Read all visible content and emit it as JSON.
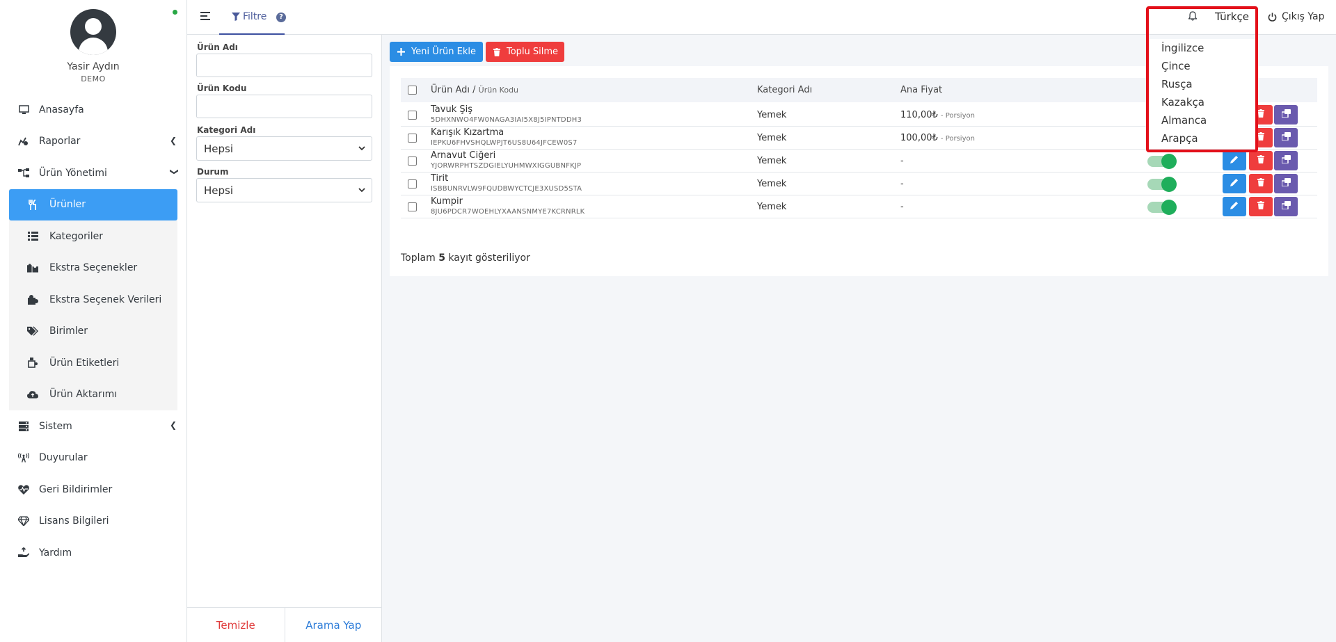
{
  "profile": {
    "name": "Yasir Aydın",
    "role": "DEMO"
  },
  "sidebar": {
    "items": [
      {
        "label": "Anasayfa",
        "icon": "monitor-icon"
      },
      {
        "label": "Raporlar",
        "icon": "reports-icon"
      },
      {
        "label": "Ürün Yönetimi",
        "icon": "sitemap-icon"
      },
      {
        "label": "Sistem",
        "icon": "server-icon"
      },
      {
        "label": "Duyurular",
        "icon": "broadcast-icon"
      },
      {
        "label": "Geri Bildirimler",
        "icon": "heart-pulse-icon"
      },
      {
        "label": "Lisans Bilgileri",
        "icon": "gem-icon"
      },
      {
        "label": "Yardım",
        "icon": "hand-holding-icon"
      }
    ],
    "sub_items": [
      {
        "label": "Ürünler",
        "icon": "utensils-icon"
      },
      {
        "label": "Kategoriler",
        "icon": "list-icon"
      },
      {
        "label": "Ekstra Seçenekler",
        "icon": "puzzle-icon"
      },
      {
        "label": "Ekstra Seçenek Verileri",
        "icon": "puzzle-piece-icon"
      },
      {
        "label": "Birimler",
        "icon": "tags-icon"
      },
      {
        "label": "Ürün Etiketleri",
        "icon": "label-icon"
      },
      {
        "label": "Ürün Aktarımı",
        "icon": "cloud-upload-icon"
      }
    ]
  },
  "topbar": {
    "filter_tab": "Filtre",
    "help": "?",
    "language": "Türkçe",
    "logout": "Çıkış Yap"
  },
  "language_menu": [
    "İngilizce",
    "Çince",
    "Rusça",
    "Kazakça",
    "Almanca",
    "Arapça"
  ],
  "filters": {
    "product_name_label": "Ürün Adı",
    "product_code_label": "Ürün Kodu",
    "category_label": "Kategori Adı",
    "category_value": "Hepsi",
    "status_label": "Durum",
    "status_value": "Hepsi",
    "clear": "Temizle",
    "search": "Arama Yap"
  },
  "toolbar": {
    "add": "Yeni Ürün Ekle",
    "bulk_delete": "Toplu Silme"
  },
  "table": {
    "col_name": "Ürün Adı /",
    "col_code": "Ürün Kodu",
    "col_category": "Kategori Adı",
    "col_price": "Ana Fiyat",
    "rows": [
      {
        "name": "Tavuk Şiş",
        "code": "5DHXNWO4FW0NAGA3IAI5X8J5IPNTDDH3",
        "category": "Yemek",
        "price": "110,00₺",
        "unit": "- Porsiyon",
        "active": true
      },
      {
        "name": "Karışık Kızartma",
        "code": "IEPKU6FHVSHQLWPJT6US8U64JFCEW0S7",
        "category": "Yemek",
        "price": "100,00₺",
        "unit": "- Porsiyon",
        "active": true
      },
      {
        "name": "Arnavut Ciğeri",
        "code": "YJORWRPHTSZDGIELYUHMWXIGGUBNFKJP",
        "category": "Yemek",
        "price": "-",
        "unit": "",
        "active": true
      },
      {
        "name": "Tirit",
        "code": "ISBBUNRVLW9FQUDBWYCTCJE3XUSD5STA",
        "category": "Yemek",
        "price": "-",
        "unit": "",
        "active": true
      },
      {
        "name": "Kumpir",
        "code": "8JU6PDCR7WOEHLYXAANSNMYE7KCRNRLK",
        "category": "Yemek",
        "price": "-",
        "unit": "",
        "active": true
      }
    ],
    "total_prefix": "Toplam",
    "total_count": "5",
    "total_suffix": "kayıt gösteriliyor"
  },
  "colors": {
    "primary": "#2b8de4",
    "danger": "#ef3d3d",
    "purple": "#6a5aae",
    "active_nav": "#3c9df4",
    "toggle_on": "#1fae5b",
    "highlight": "#e3101a"
  }
}
